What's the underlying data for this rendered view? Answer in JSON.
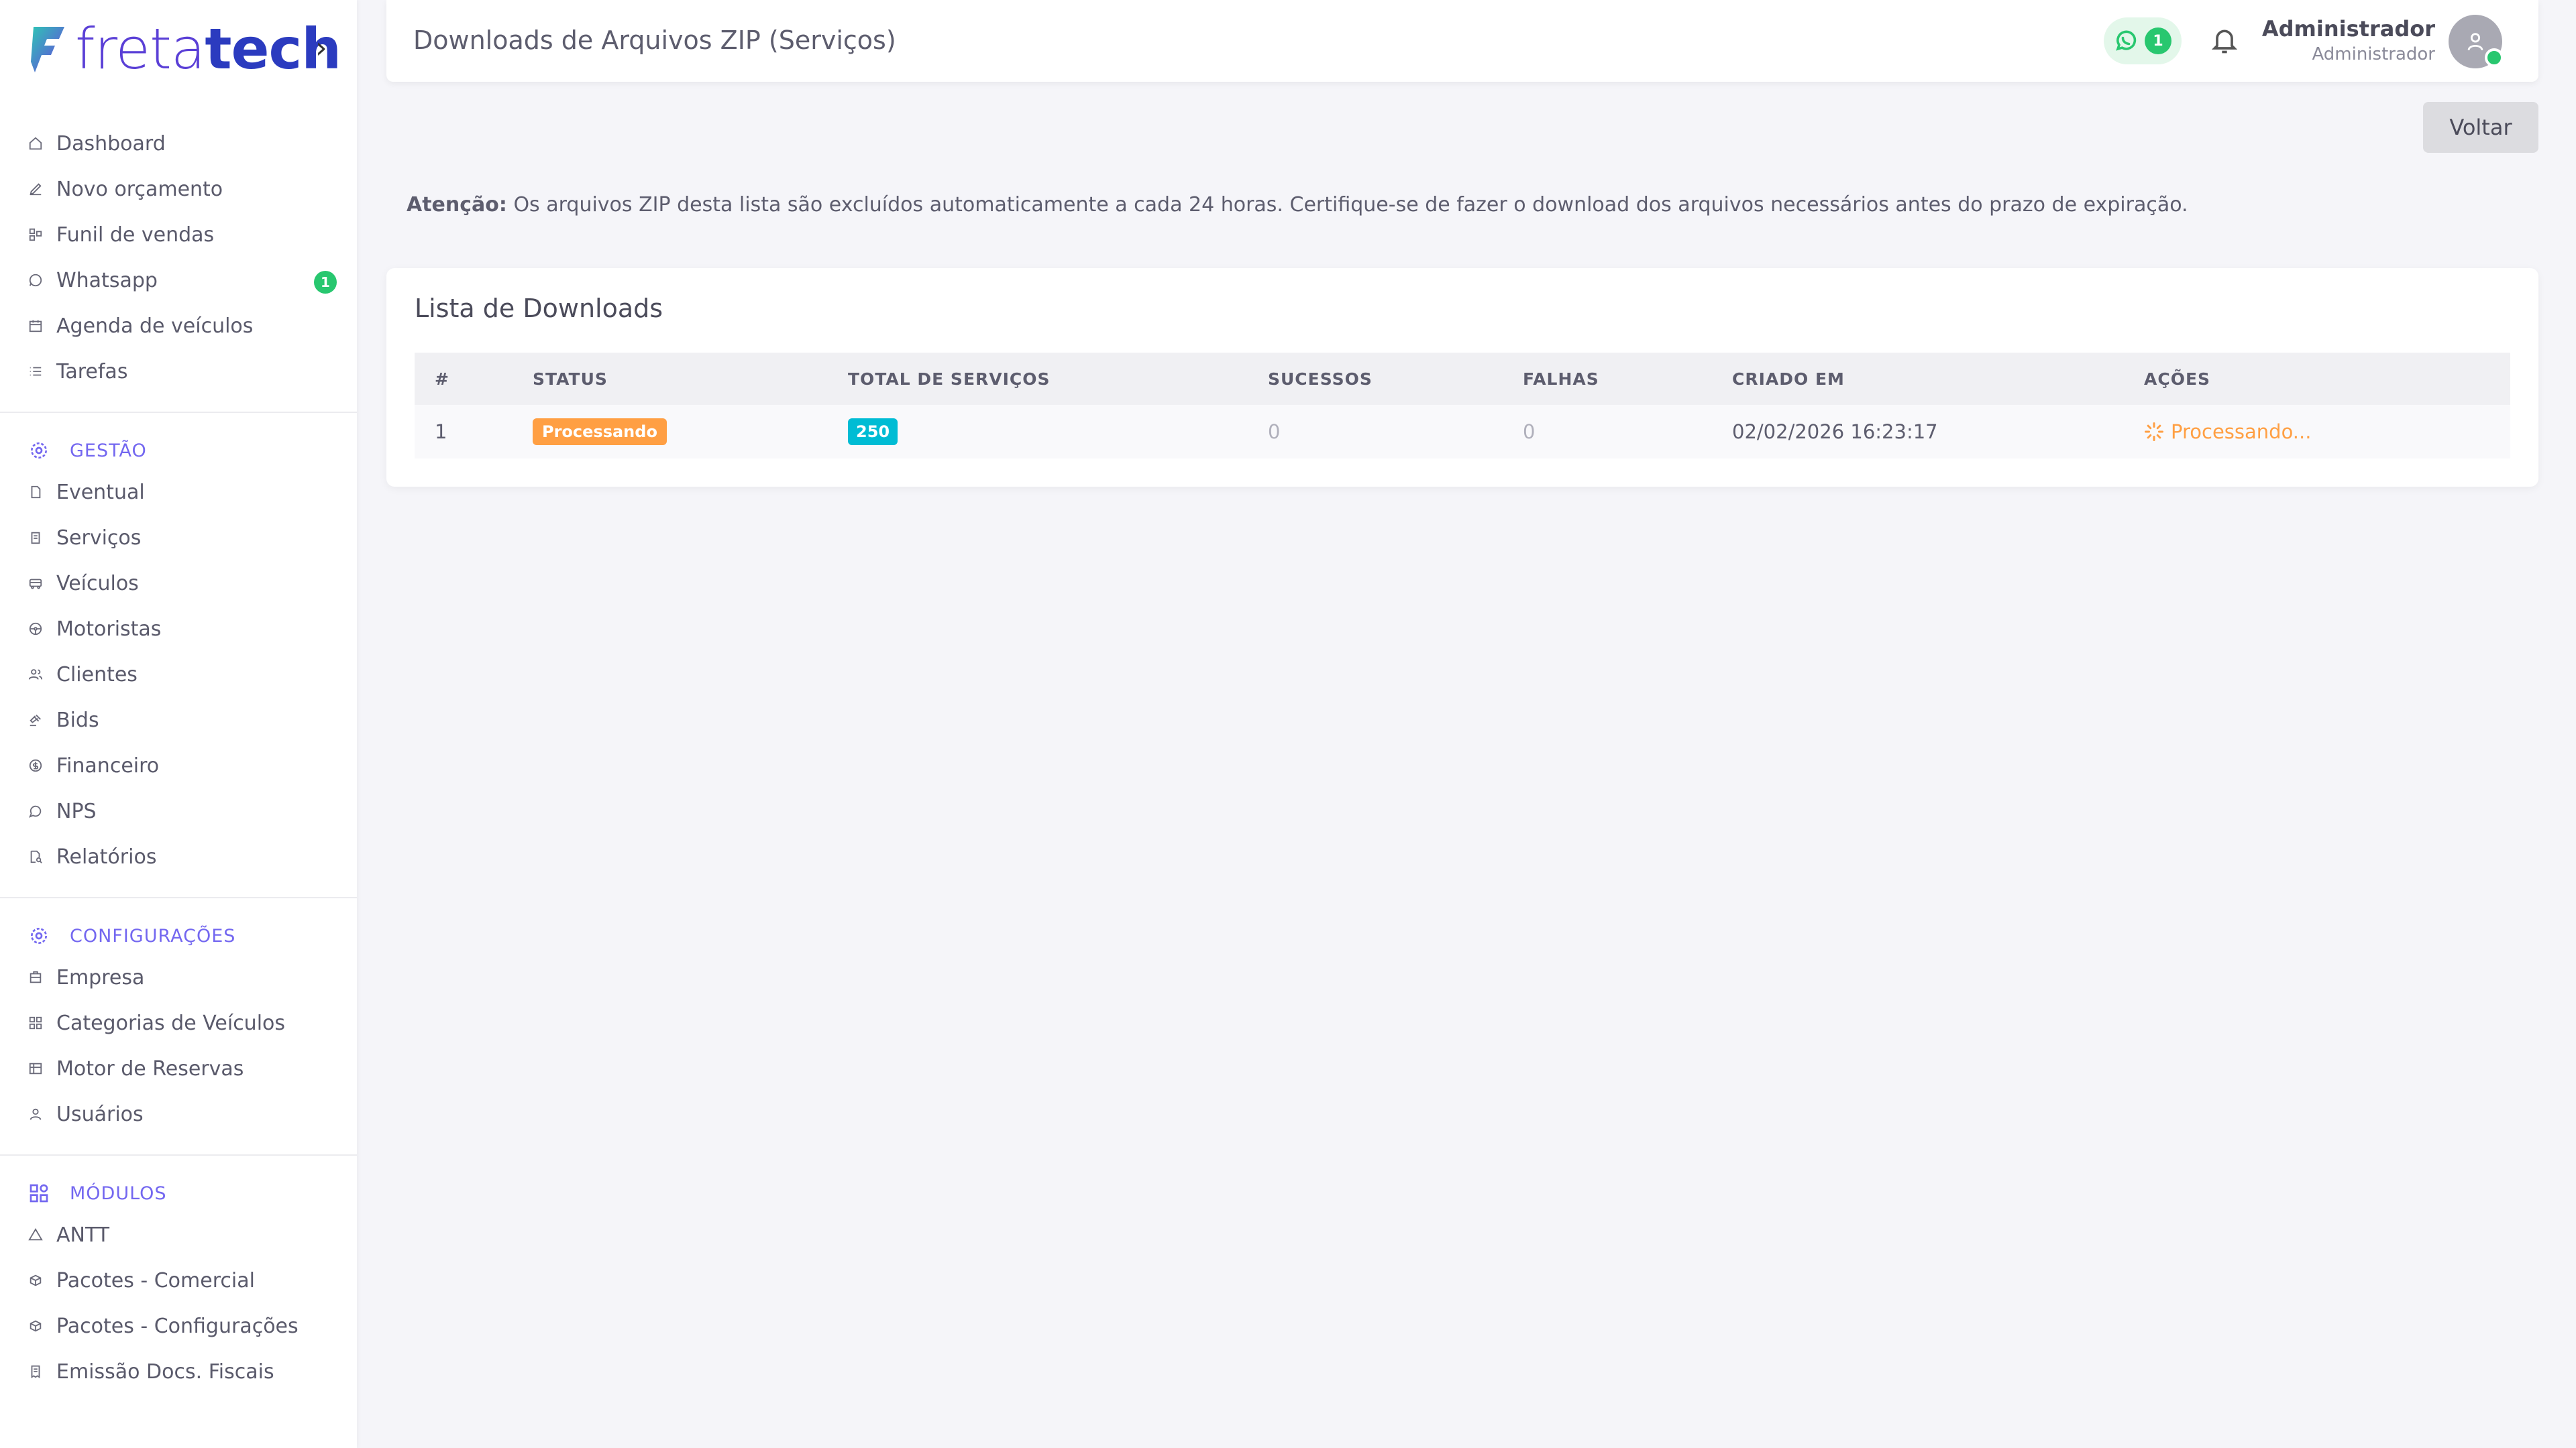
{
  "brand": {
    "logo_part1": "freta",
    "logo_part2": "tech"
  },
  "sidebar": {
    "main_items": [
      {
        "label": "Dashboard",
        "icon": "home-icon"
      },
      {
        "label": "Novo orçamento",
        "icon": "edit-icon"
      },
      {
        "label": "Funil de vendas",
        "icon": "funnel-icon"
      },
      {
        "label": "Whatsapp",
        "icon": "whatsapp-icon",
        "badge": "1"
      },
      {
        "label": "Agenda de veículos",
        "icon": "calendar-icon"
      },
      {
        "label": "Tarefas",
        "icon": "list-icon"
      }
    ],
    "sections": [
      {
        "title": "GESTÃO",
        "icon": "gear-icon",
        "items": [
          {
            "label": "Eventual"
          },
          {
            "label": "Serviços"
          },
          {
            "label": "Veículos"
          },
          {
            "label": "Motoristas"
          },
          {
            "label": "Clientes"
          },
          {
            "label": "Bids"
          },
          {
            "label": "Financeiro"
          },
          {
            "label": "NPS"
          },
          {
            "label": "Relatórios"
          }
        ]
      },
      {
        "title": "CONFIGURAÇÕES",
        "icon": "gear-icon",
        "items": [
          {
            "label": "Empresa"
          },
          {
            "label": "Categorias de Veículos"
          },
          {
            "label": "Motor de Reservas"
          },
          {
            "label": "Usuários"
          }
        ]
      },
      {
        "title": "MÓDULOS",
        "icon": "grid-icon",
        "items": [
          {
            "label": "ANTT"
          },
          {
            "label": "Pacotes - Comercial"
          },
          {
            "label": "Pacotes - Configurações"
          },
          {
            "label": "Emissão Docs. Fiscais"
          }
        ]
      }
    ]
  },
  "header": {
    "title": "Downloads de Arquivos ZIP (Serviços)",
    "whatsapp_count": "1",
    "user_name": "Administrador",
    "user_role": "Administrador"
  },
  "actions": {
    "back_label": "Voltar"
  },
  "notice": {
    "bold": "Atenção:",
    "text": " Os arquivos ZIP desta lista são excluídos automaticamente a cada 24 horas. Certifique-se de fazer o download dos arquivos necessários antes do prazo de expiração."
  },
  "downloads": {
    "title": "Lista de Downloads",
    "columns": [
      "#",
      "STATUS",
      "TOTAL DE SERVIÇOS",
      "SUCESSOS",
      "FALHAS",
      "CRIADO EM",
      "AÇÕES"
    ],
    "rows": [
      {
        "id": "1",
        "status": "Processando",
        "total": "250",
        "successes": "0",
        "failures": "0",
        "created_at": "02/02/2026 16:23:17",
        "action": "Processando..."
      }
    ]
  },
  "colors": {
    "accent": "#7367f0",
    "success": "#28c76f",
    "warning": "#ff9f43",
    "info": "#00bcd4"
  }
}
